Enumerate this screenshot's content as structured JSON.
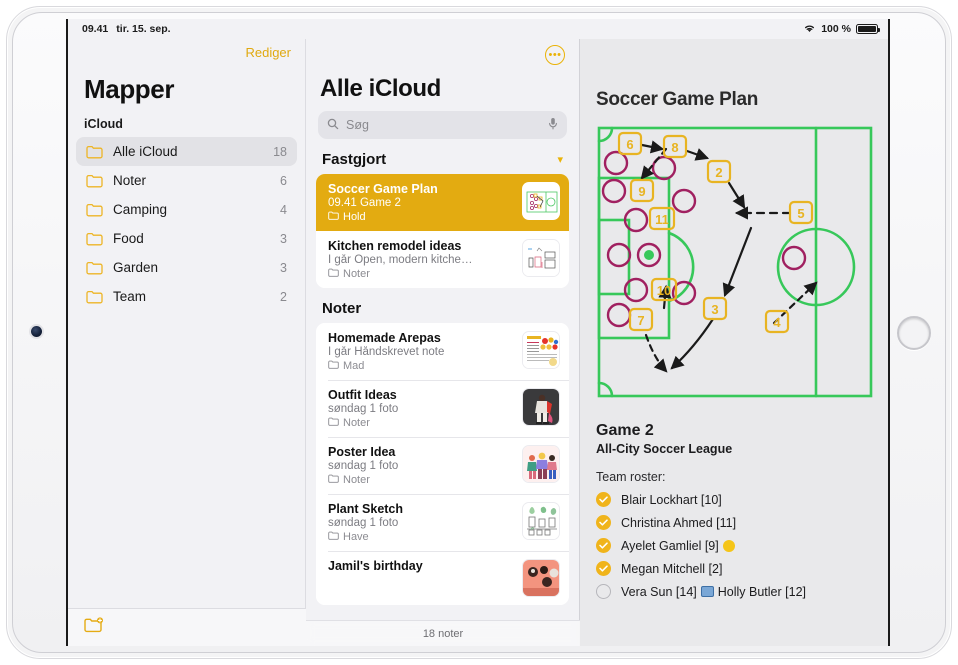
{
  "status_bar": {
    "time": "09.41",
    "date": "tir. 15. sep.",
    "wifi_icon": "wifi-icon",
    "battery_percent": "100 %",
    "battery_icon": "battery-icon"
  },
  "sidebar": {
    "edit_label": "Rediger",
    "title": "Mapper",
    "group_label": "iCloud",
    "new_folder_icon": "new-folder-icon",
    "items": [
      {
        "label": "Alle iCloud",
        "count": "18",
        "selected": true
      },
      {
        "label": "Noter",
        "count": "6",
        "selected": false
      },
      {
        "label": "Camping",
        "count": "4",
        "selected": false
      },
      {
        "label": "Food",
        "count": "3",
        "selected": false
      },
      {
        "label": "Garden",
        "count": "3",
        "selected": false
      },
      {
        "label": "Team",
        "count": "2",
        "selected": false
      }
    ]
  },
  "note_list": {
    "more_button_icon": "ellipsis-circle-icon",
    "title": "Alle iCloud",
    "search": {
      "placeholder": "Søg",
      "search_icon": "search-icon",
      "mic_icon": "microphone-icon"
    },
    "pinned_section": {
      "label": "Fastgjort",
      "chevron_icon": "chevron-down-icon",
      "items": [
        {
          "title": "Soccer Game Plan",
          "subtitle": "09.41  Game 2",
          "folder": "Hold",
          "selected": true,
          "thumb": "soccer-field-thumb"
        },
        {
          "title": "Kitchen remodel ideas",
          "subtitle": "I går  Open, modern kitche…",
          "folder": "Noter",
          "selected": false,
          "thumb": "kitchen-sketch-thumb"
        }
      ]
    },
    "notes_section": {
      "label": "Noter",
      "items": [
        {
          "title": "Homemade Arepas",
          "subtitle": "I går  Håndskrevet note",
          "folder": "Mad",
          "thumb": "recipe-card-thumb"
        },
        {
          "title": "Outfit Ideas",
          "subtitle": "søndag  1 foto",
          "folder": "Noter",
          "thumb": "outfit-photo-thumb"
        },
        {
          "title": "Poster Idea",
          "subtitle": "søndag  1 foto",
          "folder": "Noter",
          "thumb": "people-illustration-thumb"
        },
        {
          "title": "Plant Sketch",
          "subtitle": "søndag  1 foto",
          "folder": "Have",
          "thumb": "plants-sketch-thumb"
        },
        {
          "title": "Jamil's birthday",
          "subtitle": "",
          "folder": "",
          "thumb": "birthday-cake-thumb"
        }
      ]
    },
    "footer_count": "18 noter"
  },
  "detail": {
    "title": "Soccer Game Plan",
    "sketch": {
      "name": "soccer-field-sketch",
      "field_color": "#37c85a",
      "player_color": "#a02060",
      "tag_color": "#e8b422",
      "arrow_color": "#1a1a1a",
      "tags": [
        "6",
        "8",
        "2",
        "5",
        "9",
        "11",
        "10",
        "7",
        "3",
        "4"
      ]
    },
    "game_title": "Game 2",
    "league": "All-City Soccer League",
    "roster_label": "Team roster:",
    "roster": [
      {
        "name": "Blair Lockhart [10]",
        "checked": true,
        "ball": false
      },
      {
        "name": "Christina Ahmed [11]",
        "checked": true,
        "ball": false
      },
      {
        "name": "Ayelet Gamliel [9]",
        "checked": true,
        "ball": true
      },
      {
        "name": "Megan Mitchell [2]",
        "checked": true,
        "ball": false
      },
      {
        "name": "Vera Sun [14]",
        "checked": false,
        "ball": false,
        "trailing": "Holly Butler [12]"
      }
    ]
  }
}
